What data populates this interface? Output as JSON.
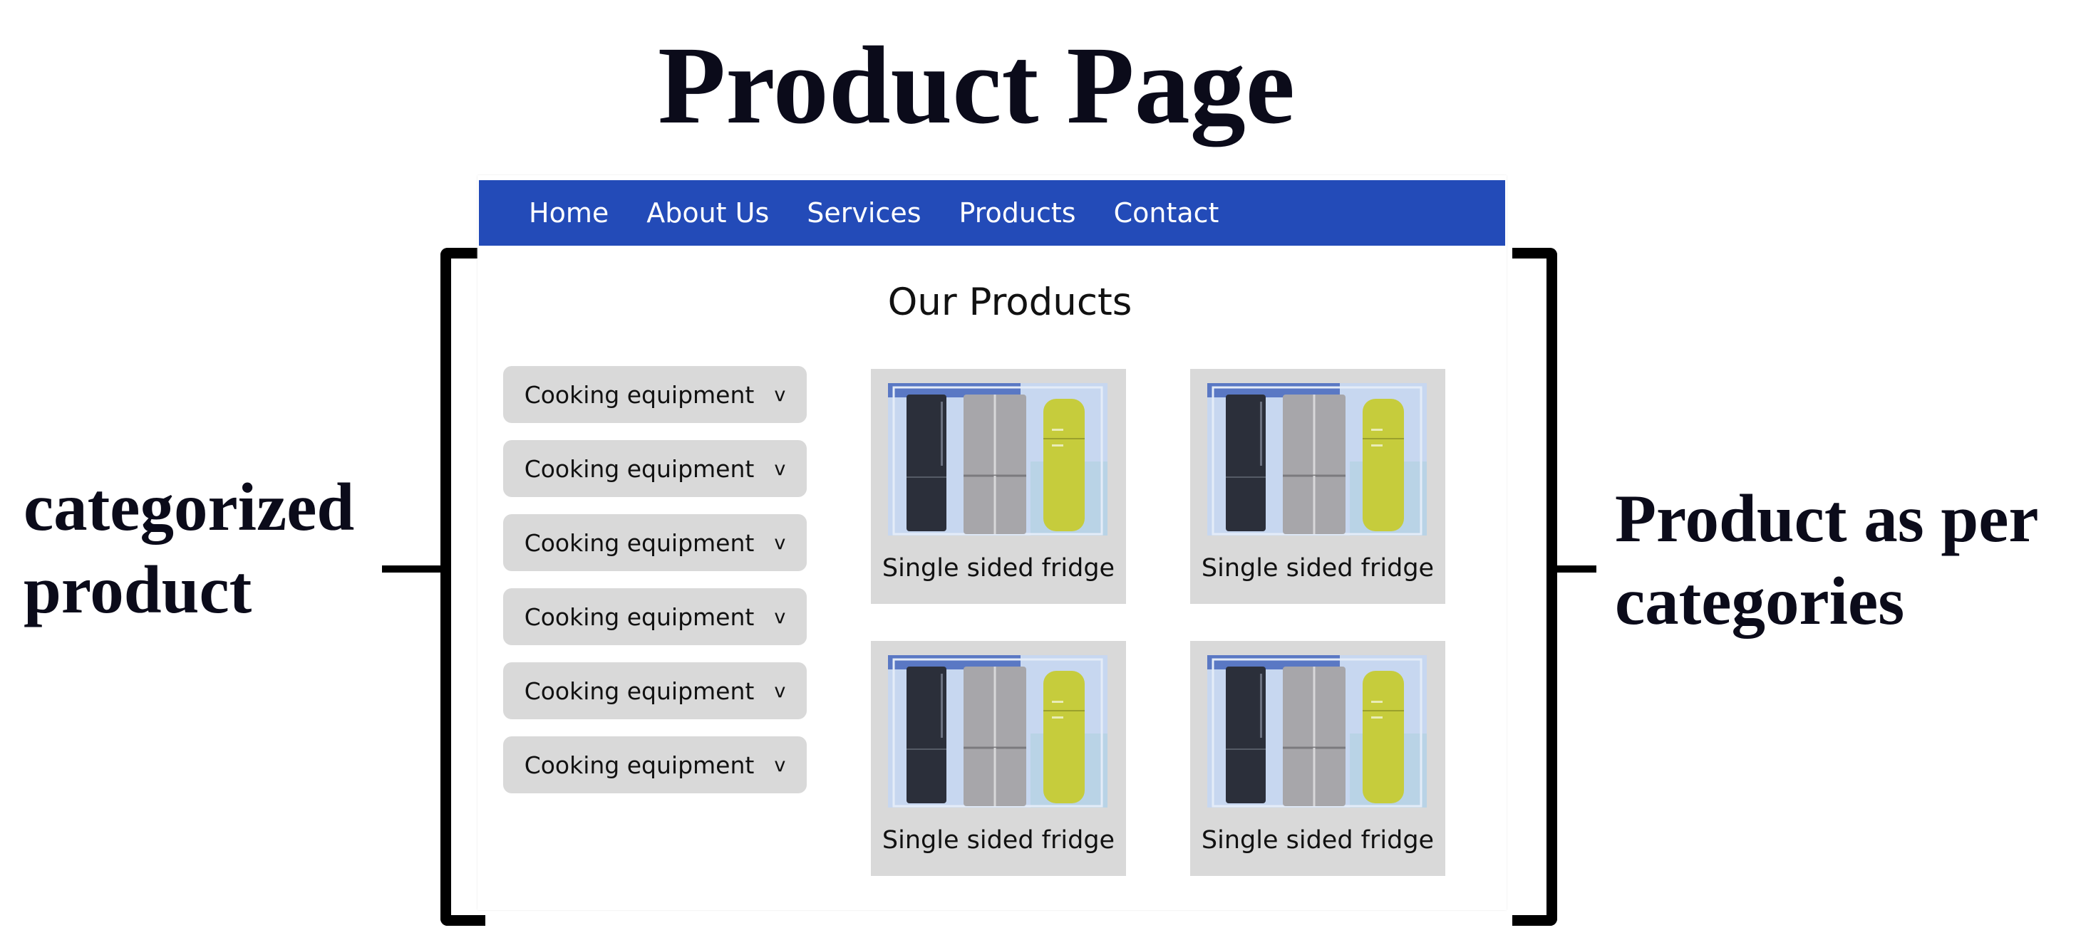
{
  "title": "Product Page",
  "left_annotation": [
    "categorized",
    "product"
  ],
  "right_annotation": [
    "Product as per",
    "categories"
  ],
  "nav": {
    "items": [
      "Home",
      "About Us",
      "Services",
      "Products",
      "Contact"
    ]
  },
  "products_heading": "Our Products",
  "categories": [
    {
      "label": "Cooking equipment",
      "chevron": "v"
    },
    {
      "label": "Cooking equipment",
      "chevron": "v"
    },
    {
      "label": "Cooking equipment",
      "chevron": "v"
    },
    {
      "label": "Cooking equipment",
      "chevron": "v"
    },
    {
      "label": "Cooking equipment",
      "chevron": "v"
    },
    {
      "label": "Cooking equipment",
      "chevron": "v"
    }
  ],
  "products": [
    {
      "name": "Single sided fridge",
      "image": "fridge-lineup-image"
    },
    {
      "name": "Single sided fridge",
      "image": "fridge-lineup-image"
    },
    {
      "name": "Single sided fridge",
      "image": "fridge-lineup-image"
    },
    {
      "name": "Single sided fridge",
      "image": "fridge-lineup-image"
    }
  ],
  "colors": {
    "nav": "#234bb8",
    "panel": "#d9d9d9",
    "fridge_accent": "#c6cc3c"
  }
}
